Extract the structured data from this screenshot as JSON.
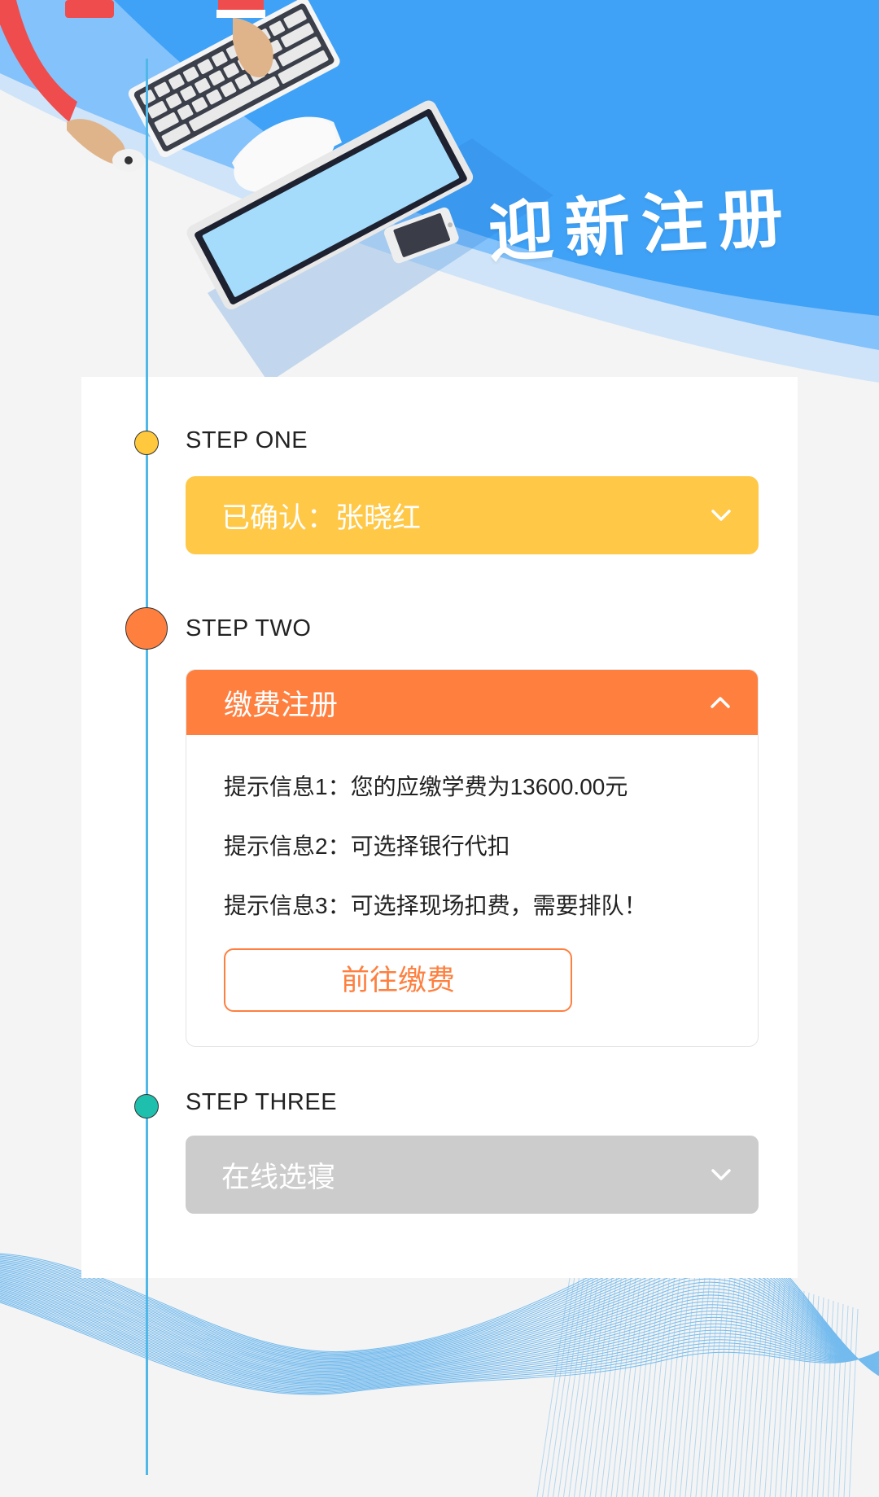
{
  "banner": {
    "title": "迎新注册"
  },
  "steps": [
    {
      "label": "STEP ONE"
    },
    {
      "label": "STEP TWO"
    },
    {
      "label": "STEP THREE"
    }
  ],
  "panels": {
    "one": {
      "title": "已确认：张晓红",
      "state": "collapsed"
    },
    "two": {
      "title": "缴费注册",
      "state": "expanded",
      "infos": [
        "提示信息1：您的应缴学费为13600.00元",
        "提示信息2：可选择银行代扣",
        "提示信息3：可选择现场扣费，需要排队！"
      ],
      "button": "前往缴费"
    },
    "three": {
      "title": "在线选寝",
      "state": "collapsed"
    }
  },
  "colors": {
    "step_one": "#ffc847",
    "step_two": "#ff7f3f",
    "step_three": "#cccccc",
    "timeline": "#4fb8e8",
    "banner_blue": "#3fa2f7"
  },
  "icons": {
    "panel_one": "chevron-down-icon",
    "panel_two": "chevron-up-icon",
    "panel_three": "chevron-down-icon"
  }
}
